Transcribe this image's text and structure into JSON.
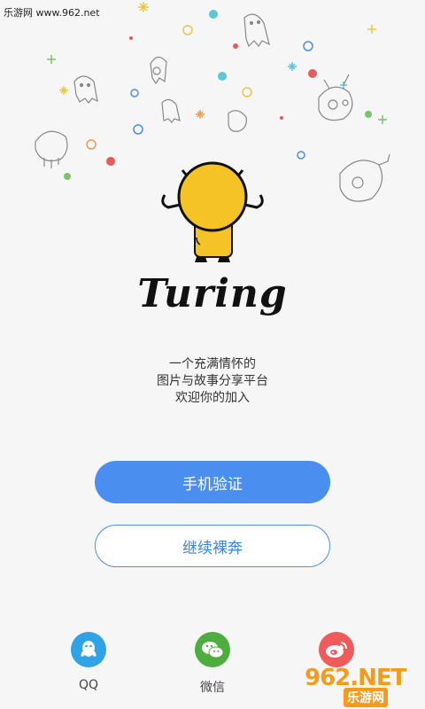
{
  "watermark_top": "乐游网 www.962.net",
  "brand": {
    "logo_text": "Turing"
  },
  "tagline": [
    "一个充满情怀的",
    "图片与故事分享平台",
    "欢迎你的加入"
  ],
  "buttons": {
    "phone_verify": "手机验证",
    "continue_guest": "继续裸奔"
  },
  "social": [
    {
      "label": "QQ",
      "icon": "qq-icon",
      "color": "#2fa3e6"
    },
    {
      "label": "微信",
      "icon": "wechat-icon",
      "color": "#4dae3f"
    },
    {
      "label": "",
      "icon": "weibo-icon",
      "color": "#ef5a5a"
    }
  ],
  "watermark_bottom": {
    "main": "962.NET",
    "sub": "乐游网"
  },
  "colors": {
    "primary": "#4a8ff0",
    "mascot": "#f6c326",
    "background": "#f6f6f6"
  }
}
